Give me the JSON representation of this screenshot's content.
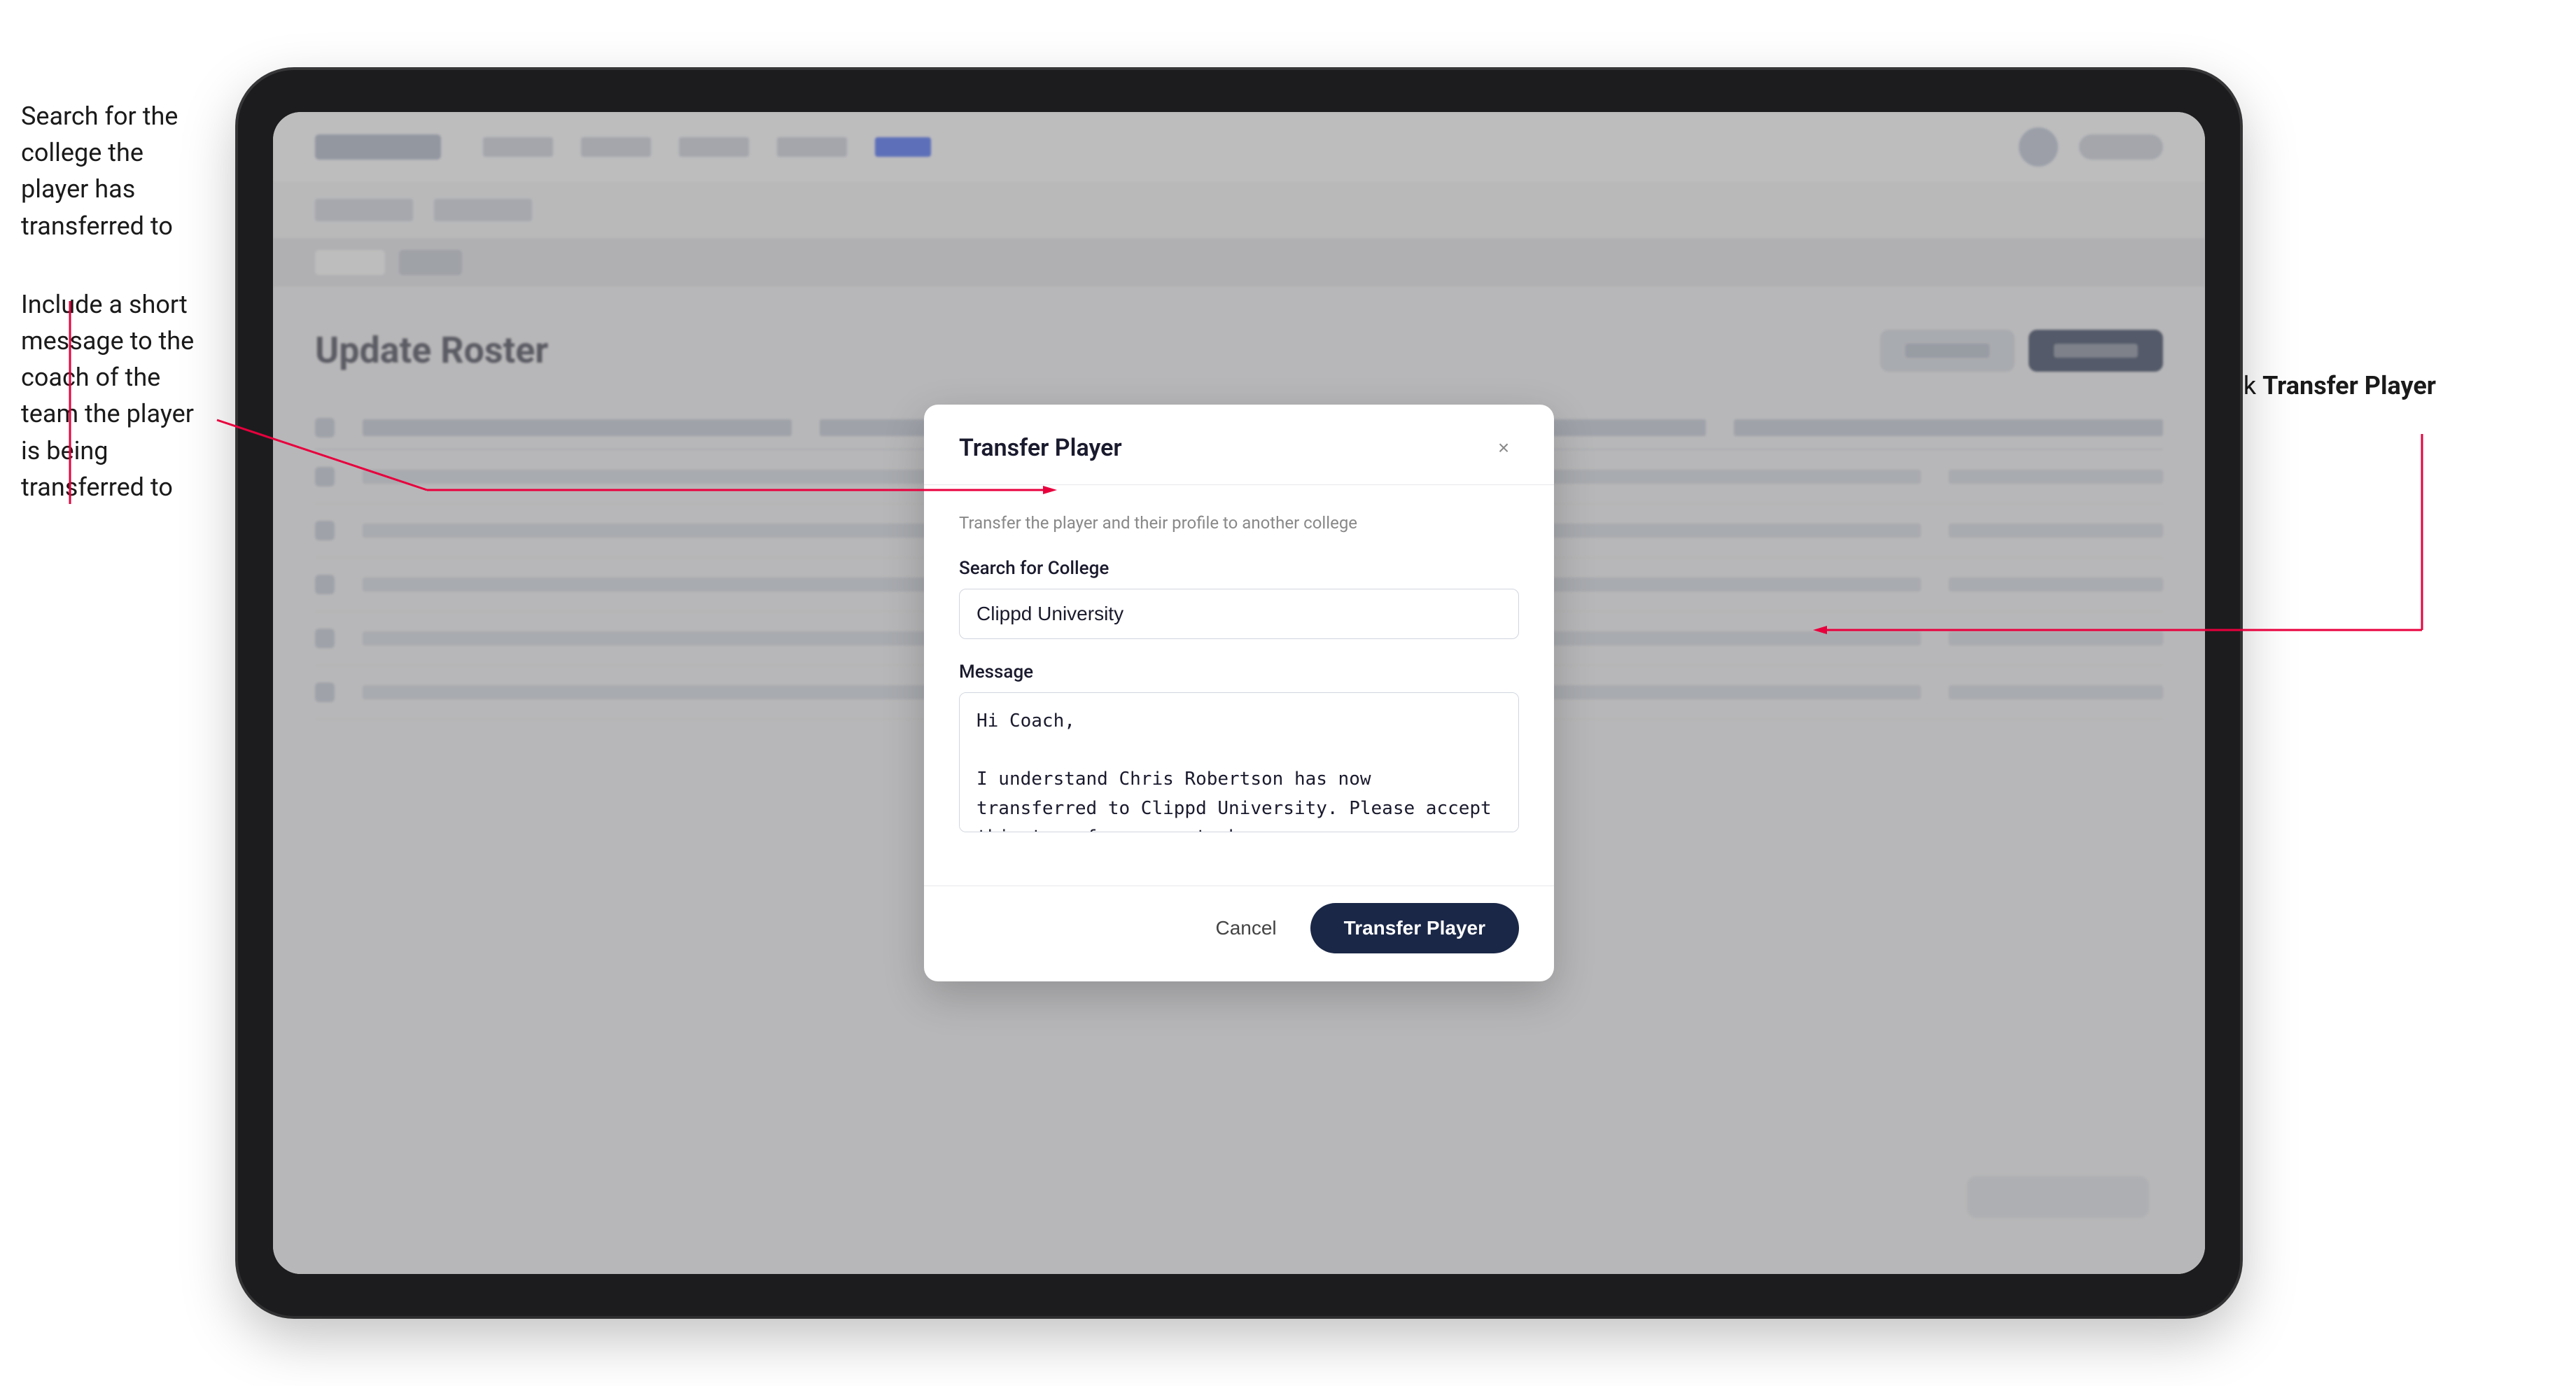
{
  "annotations": {
    "left_title1": "Search for the college the player has transferred to",
    "left_title2": "Include a short message to the coach of the team the player is being transferred to",
    "right_label_prefix": "Click ",
    "right_label_bold": "Transfer Player"
  },
  "modal": {
    "title": "Transfer Player",
    "subtitle": "Transfer the player and their profile to another college",
    "search_label": "Search for College",
    "search_value": "Clippd University",
    "message_label": "Message",
    "message_value": "Hi Coach,\n\nI understand Chris Robertson has now transferred to Clippd University. Please accept this transfer request when you can.",
    "cancel_label": "Cancel",
    "transfer_label": "Transfer Player",
    "close_icon": "×"
  },
  "page": {
    "title": "Update Roster"
  }
}
